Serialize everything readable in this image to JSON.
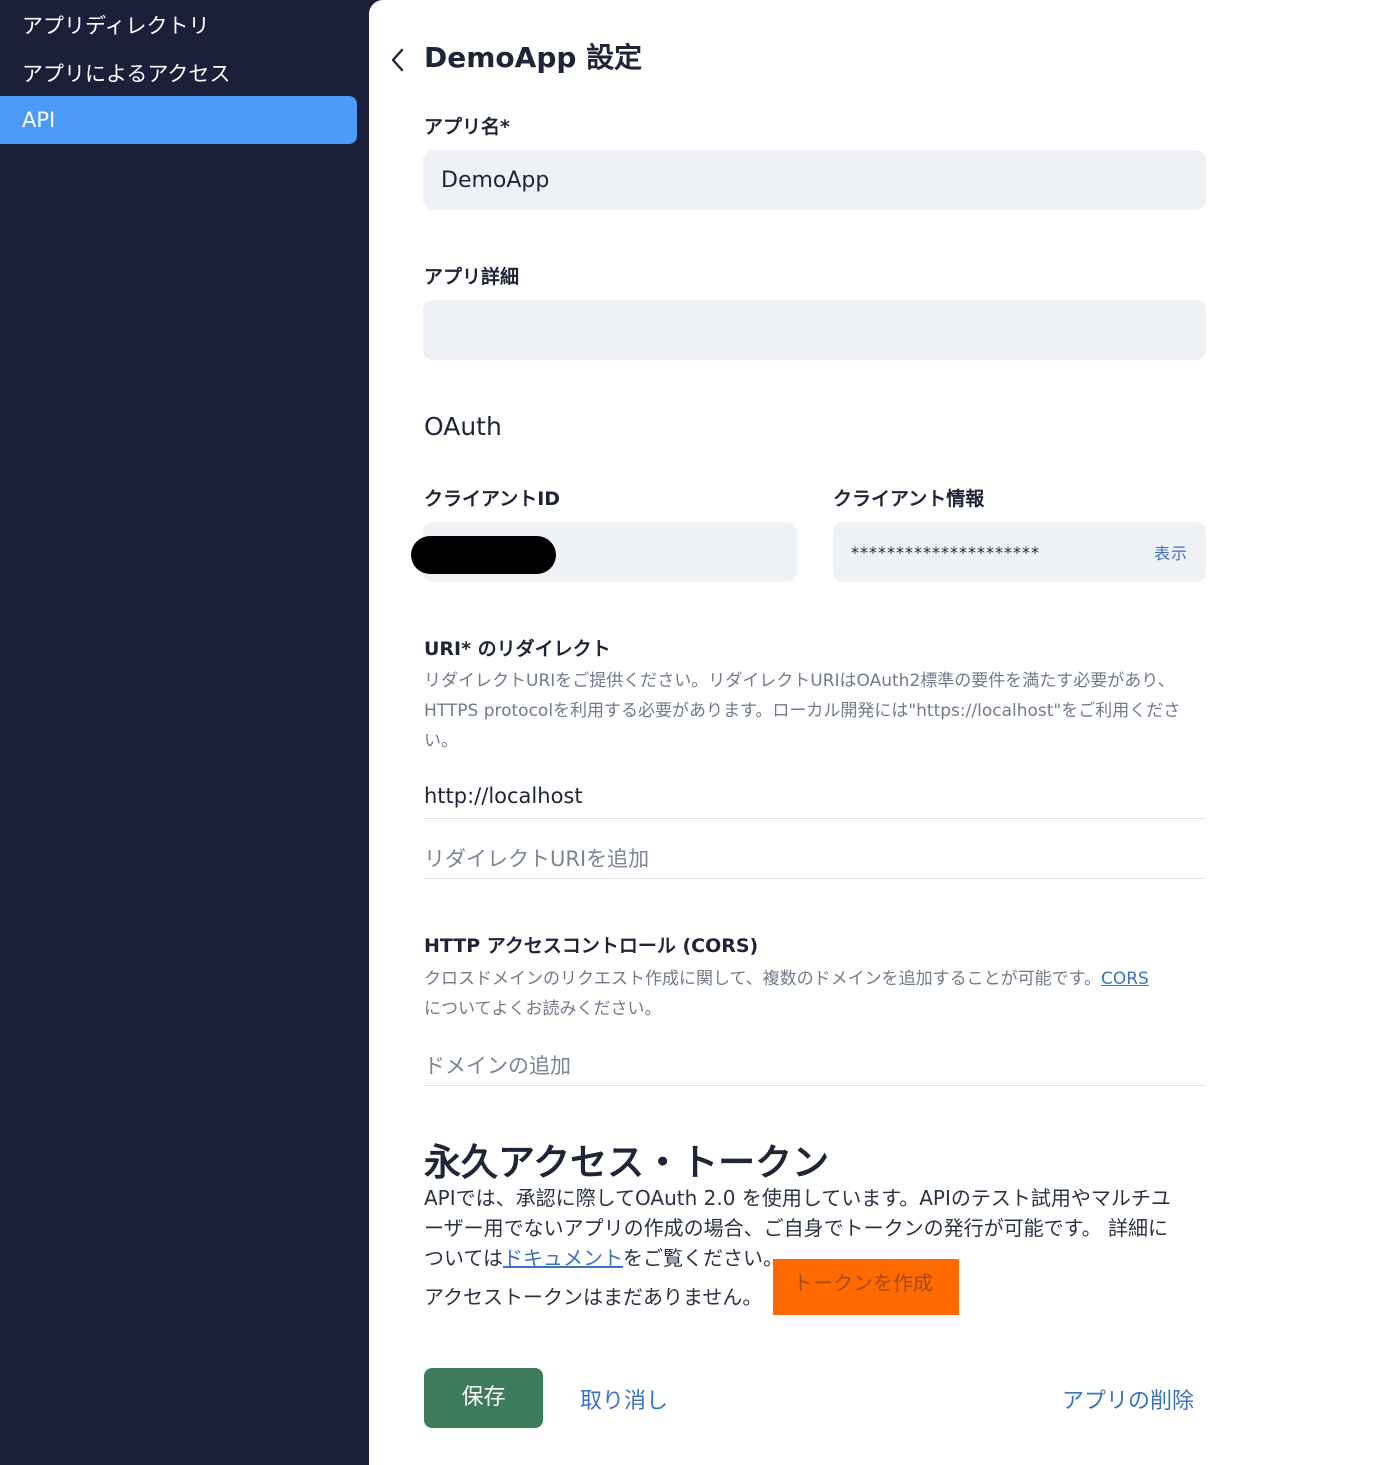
{
  "sidebar": {
    "items": [
      {
        "label": "アプリディレクトリ"
      },
      {
        "label": "アプリによるアクセス"
      },
      {
        "label": "API"
      }
    ]
  },
  "header": {
    "title": "DemoApp 設定"
  },
  "form": {
    "app_name_label": "アプリ名*",
    "app_name_value": "DemoApp",
    "app_detail_label": "アプリ詳細",
    "app_detail_value": ""
  },
  "oauth": {
    "title": "OAuth",
    "client_id_label": "クライアントID",
    "client_id_value": "",
    "client_secret_label": "クライアント情報",
    "client_secret_value": "*********************",
    "reveal_label": "表示"
  },
  "redirect": {
    "title": "URI* のリダイレクト",
    "help_line1": "リダイレクトURIをご提供ください。リダイレクトURIはOAuth2標準の要件を満たす必要があり、",
    "help_line2": "HTTPS protocolを利用する必要があります。ローカル開発には\"https://localhost\"をご利用くださ",
    "help_line3": "い。",
    "uri_value": "http://localhost",
    "add_placeholder": "リダイレクトURIを追加"
  },
  "cors": {
    "title": "HTTP アクセスコントロール (CORS)",
    "help_before": "クロスドメインのリクエスト作成に関して、複数のドメインを追加することが可能です。",
    "help_link": "CORS",
    "help_after": "についてよくお読みください。",
    "add_placeholder": "ドメインの追加"
  },
  "token": {
    "title": "永久アクセス・トークン",
    "desc_line1": "APIでは、承認に際してOAuth 2.0 を使用しています。APIのテスト試用やマルチユ",
    "desc_line2": "ーザー用でないアプリの作成の場合、ご自身でトークンの発行が可能です。 詳細に",
    "desc_line3_before": "ついては",
    "desc_link": "ドキュメント",
    "desc_line3_after": "をご覧ください。",
    "none_text": "アクセストークンはまだありません。",
    "create_label": "トークンを作成"
  },
  "actions": {
    "save_label": "保存",
    "cancel_label": "取り消し",
    "delete_label": "アプリの削除"
  }
}
